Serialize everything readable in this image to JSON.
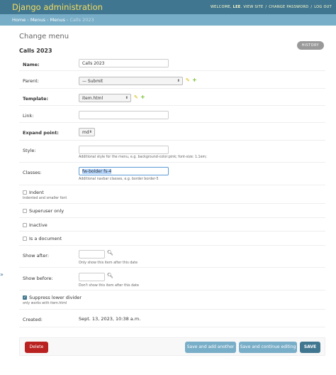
{
  "header": {
    "branding": "Django administration",
    "welcome": "WELCOME,",
    "username": "LEE",
    "view_site": "VIEW SITE",
    "change_password": "CHANGE PASSWORD",
    "logout": "LOG OUT",
    "separator": "/"
  },
  "breadcrumbs": {
    "items": [
      "Home",
      "Menus",
      "Menus"
    ],
    "current": "Calls 2023",
    "separator": "›"
  },
  "sidebar_toggle": "»",
  "page_title": "Change menu",
  "object_heading": "Calls 2023",
  "history_label": "HISTORY",
  "fields": {
    "name": {
      "label": "Name:",
      "value": "Calls 2023"
    },
    "parent": {
      "label": "Parent:",
      "value": "— Submit"
    },
    "template": {
      "label": "Template:",
      "value": "item.html"
    },
    "link": {
      "label": "Link:",
      "value": ""
    },
    "expand_point": {
      "label": "Expand point:",
      "value": "md"
    },
    "style": {
      "label": "Style:",
      "value": "",
      "help": "Additional style for the menu, e.g. background-color:pink; font-size: 1.1em;"
    },
    "classes": {
      "label": "Classes:",
      "value": "fw-bolder fs-4",
      "help": "Additional navbar classes, e.g. border border-5"
    },
    "indent": {
      "label": "Indent",
      "checked": false,
      "help": "Indented and smaller font"
    },
    "superuser_only": {
      "label": "Superuser only",
      "checked": false
    },
    "inactive": {
      "label": "Inactive",
      "checked": false
    },
    "is_document": {
      "label": "Is a document",
      "checked": false
    },
    "show_after": {
      "label": "Show after:",
      "value": "",
      "help": "Only show this item after this date"
    },
    "show_before": {
      "label": "Show before:",
      "value": "",
      "help": "Don't show this item after this date"
    },
    "suppress_divider": {
      "label": "Suppress lower divider",
      "checked": true,
      "help": "only works with item.html"
    },
    "created": {
      "label": "Created:",
      "value": "Sept. 13, 2023, 10:38 a.m."
    }
  },
  "buttons": {
    "delete": "Delete",
    "save_add_another": "Save and add another",
    "save_continue": "Save and continue editing",
    "save": "SAVE"
  },
  "colors": {
    "header_bg": "#417690",
    "branding": "#f5dd5d",
    "breadcrumbs_bg": "#79aec8",
    "delete": "#ba2121",
    "save": "#417690"
  }
}
